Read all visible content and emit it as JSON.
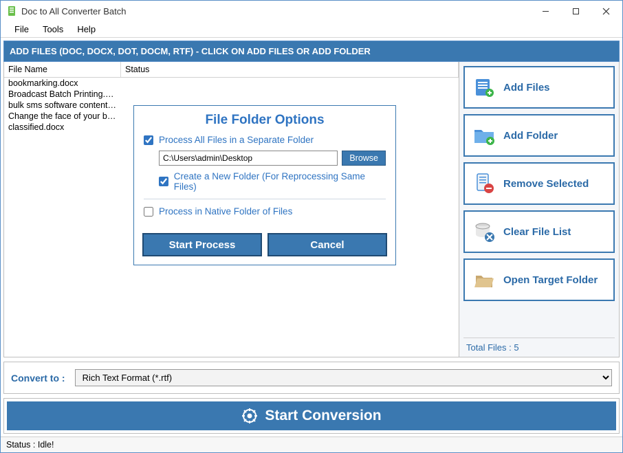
{
  "title": "Doc to All Converter Batch",
  "menu": {
    "file": "File",
    "tools": "Tools",
    "help": "Help"
  },
  "banner": "ADD FILES (DOC, DOCX, DOT, DOCM, RTF) - CLICK ON ADD FILES OR ADD FOLDER",
  "columns": {
    "name": "File Name",
    "status": "Status"
  },
  "files": [
    {
      "name": "bookmarking.docx",
      "status": ""
    },
    {
      "name": "Broadcast Batch Printing.d...",
      "status": ""
    },
    {
      "name": "bulk sms software content-...",
      "status": ""
    },
    {
      "name": "Change the face of your bu...",
      "status": ""
    },
    {
      "name": "classified.docx",
      "status": ""
    }
  ],
  "side": {
    "add_files": "Add Files",
    "add_folder": "Add Folder",
    "remove_selected": "Remove Selected",
    "clear_list": "Clear File List",
    "open_target": "Open Target Folder",
    "total_label": "Total Files :",
    "total_count": "5"
  },
  "modal": {
    "title": "File Folder Options",
    "process_all": "Process All Files in a Separate Folder",
    "path": "C:\\Users\\admin\\Desktop",
    "browse": "Browse",
    "create_new": "Create a New Folder (For Reprocessing Same Files)",
    "process_native": "Process in Native Folder of Files",
    "start": "Start Process",
    "cancel": "Cancel"
  },
  "convert": {
    "label": "Convert to :",
    "selected": "Rich Text Format (*.rtf)"
  },
  "start_conversion": "Start Conversion",
  "status": "Status  :  Idle!"
}
